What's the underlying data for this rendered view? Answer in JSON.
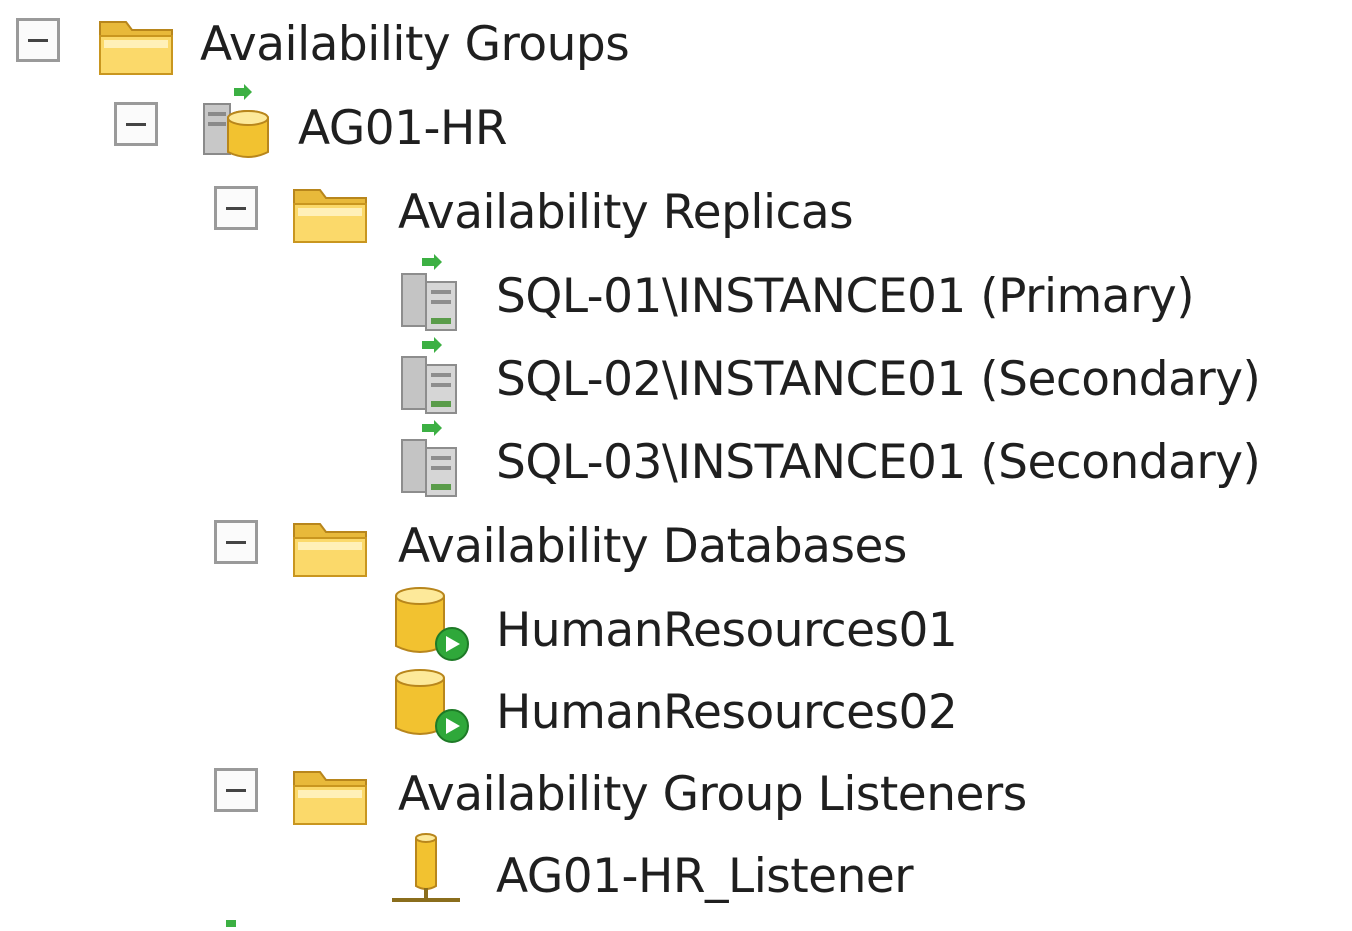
{
  "tree": {
    "root": {
      "label": "Availability Groups",
      "icon": "folder-icon",
      "expanded": true
    },
    "group": {
      "label": "AG01-HR",
      "icon": "availability-group-icon",
      "expanded": true
    },
    "replicas_folder": {
      "label": "Availability Replicas",
      "icon": "folder-icon",
      "expanded": true
    },
    "replicas": [
      {
        "label": "SQL-01\\INSTANCE01 (Primary)",
        "icon": "replica-server-icon"
      },
      {
        "label": "SQL-02\\INSTANCE01 (Secondary)",
        "icon": "replica-server-icon"
      },
      {
        "label": "SQL-03\\INSTANCE01 (Secondary)",
        "icon": "replica-server-icon"
      }
    ],
    "databases_folder": {
      "label": "Availability Databases",
      "icon": "folder-icon",
      "expanded": true
    },
    "databases": [
      {
        "label": "HumanResources01",
        "icon": "database-synchronized-icon"
      },
      {
        "label": "HumanResources02",
        "icon": "database-synchronized-icon"
      }
    ],
    "listeners_folder": {
      "label": "Availability Group Listeners",
      "icon": "folder-icon",
      "expanded": true
    },
    "listeners": [
      {
        "label": "AG01-HR_Listener",
        "icon": "listener-icon"
      }
    ]
  },
  "colors": {
    "folder": "#e8b93a",
    "folder_light": "#fde99a",
    "expander_border": "#9a9a9a",
    "status_green": "#2fa83a"
  }
}
